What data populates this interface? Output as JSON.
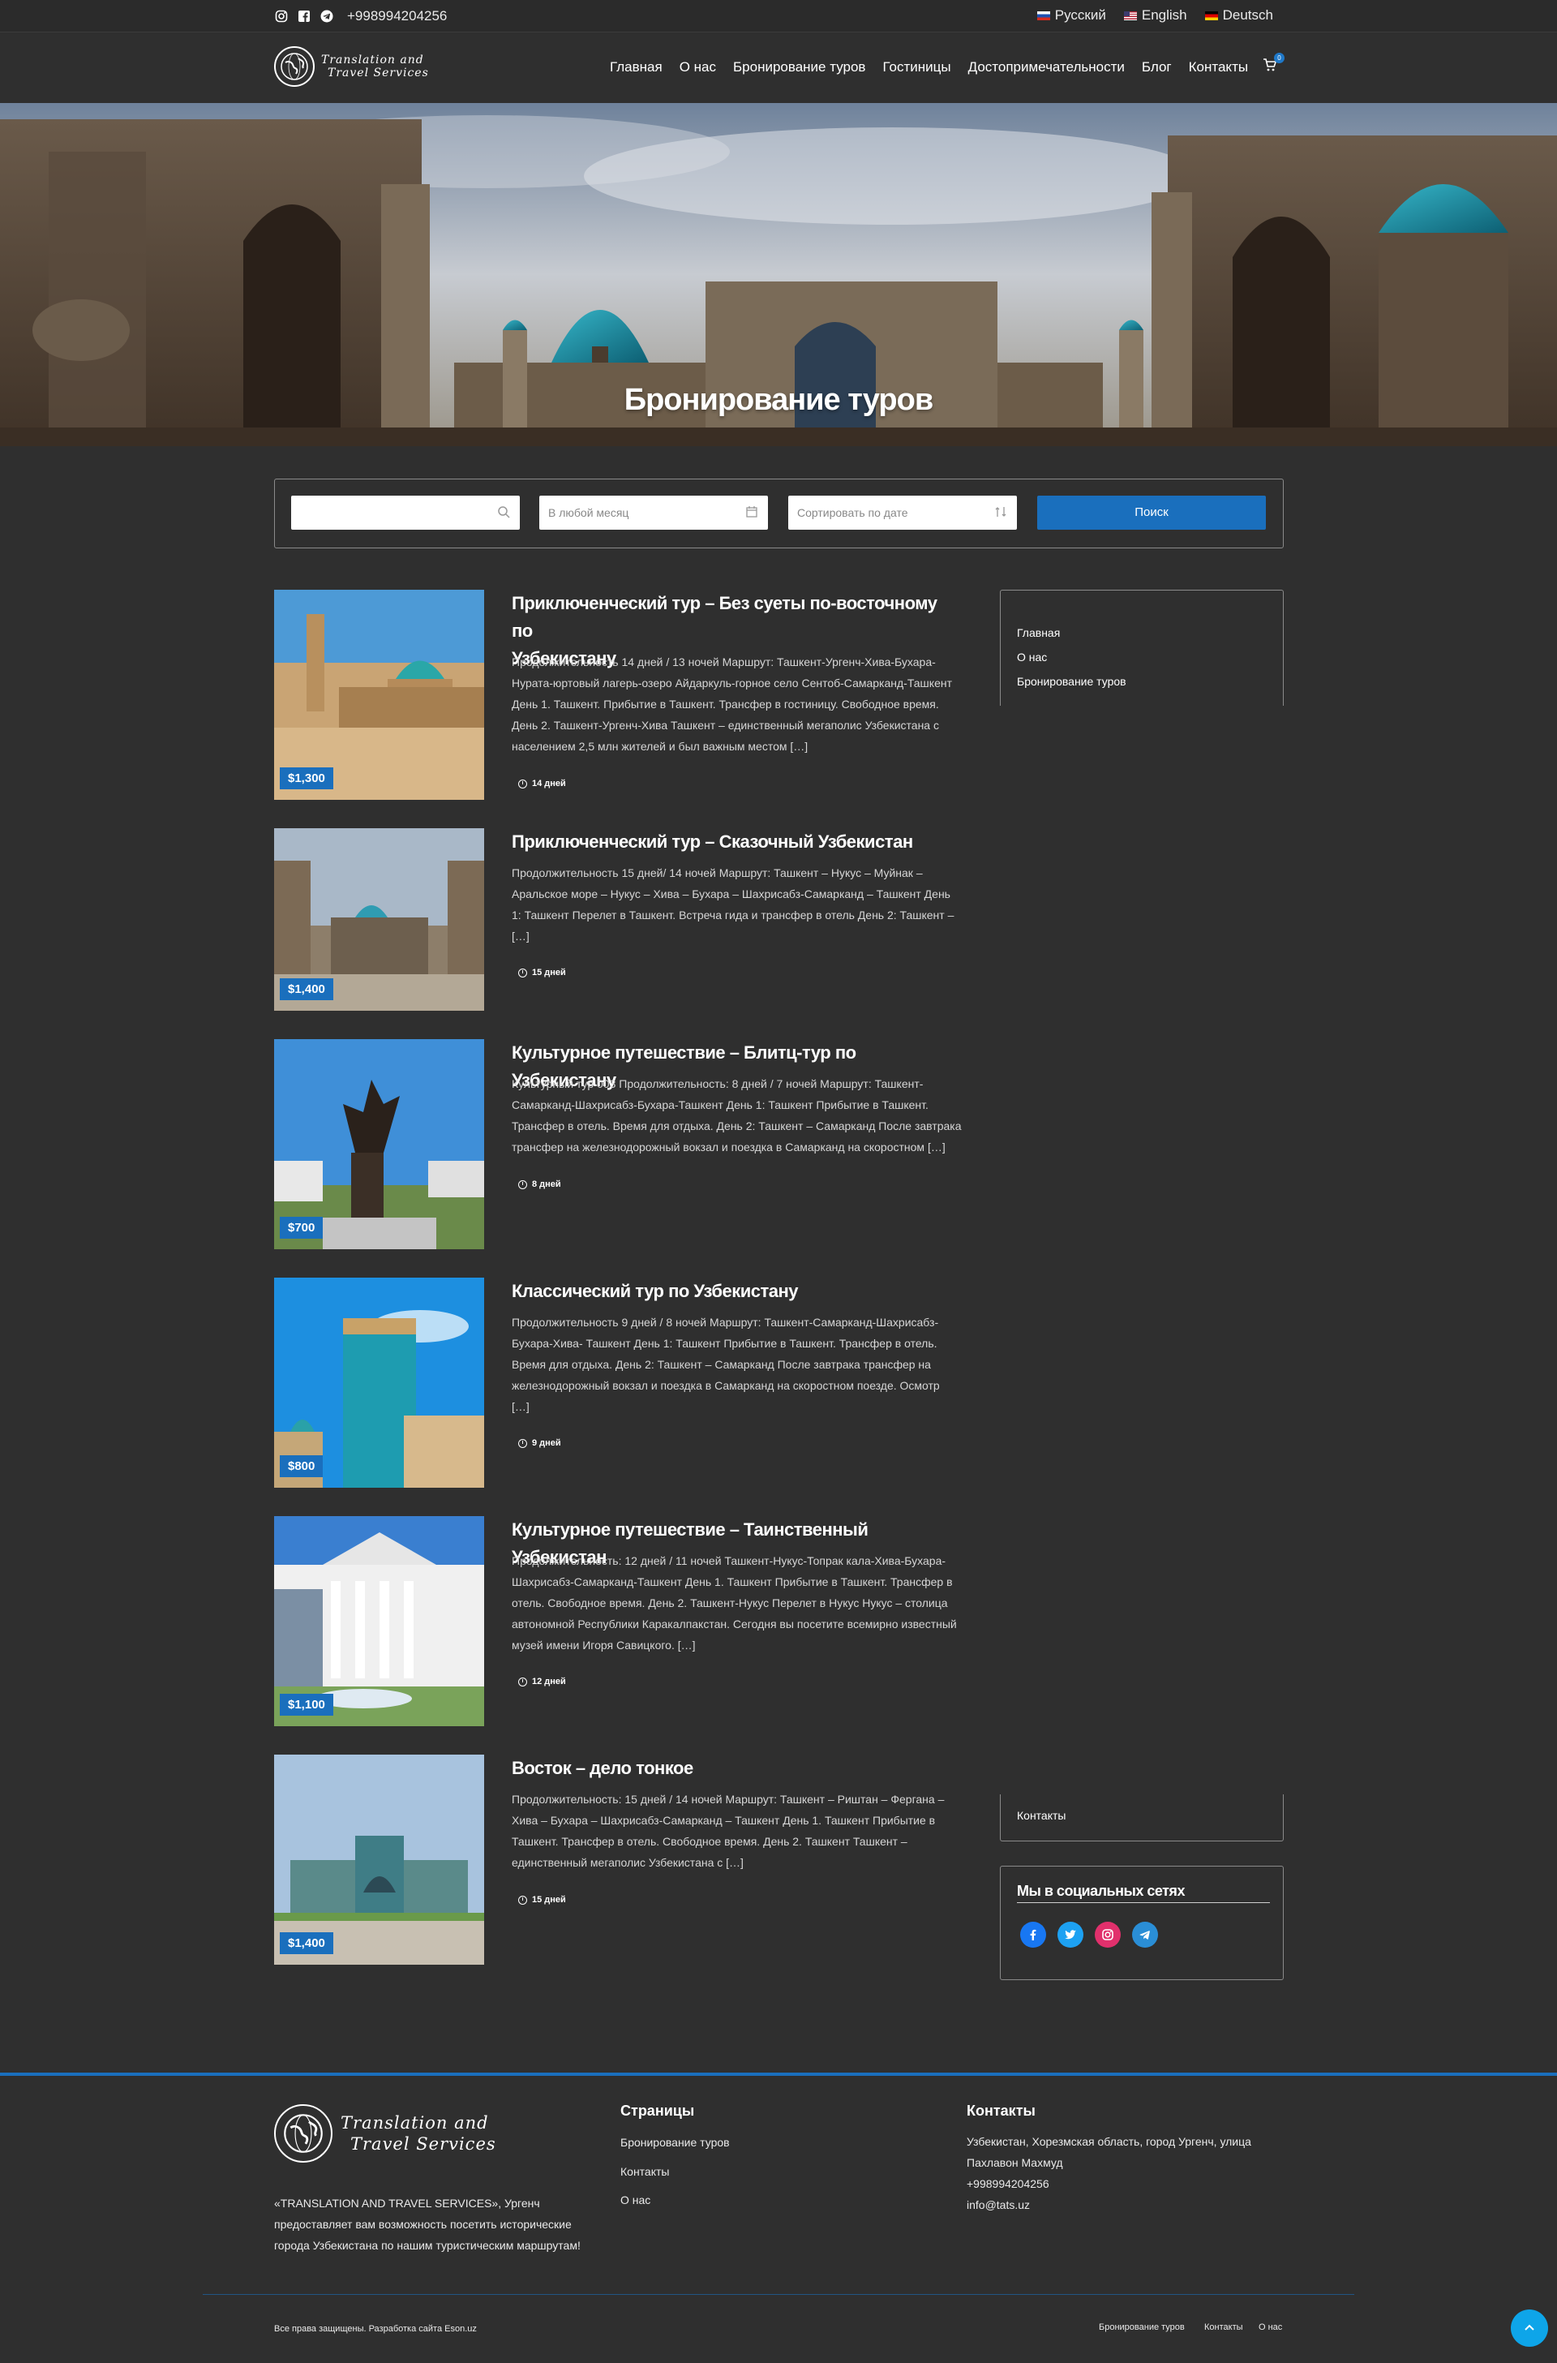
{
  "topbar": {
    "phone": "+998994204256",
    "languages": [
      {
        "label": "Русский",
        "flag": "ru"
      },
      {
        "label": "English",
        "flag": "en"
      },
      {
        "label": "Deutsch",
        "flag": "de"
      }
    ]
  },
  "header": {
    "logo_line1": "Translation and",
    "logo_line2": "Travel Services",
    "nav": [
      "Главная",
      "О нас",
      "Бронирование туров",
      "Гостиницы",
      "Достопримечательности",
      "Блог",
      "Контакты"
    ],
    "cart_count": "0"
  },
  "hero": {
    "title": "Бронирование туров"
  },
  "search": {
    "keyword_placeholder": "",
    "month_placeholder": "В любой месяц",
    "sort_placeholder": "Сортировать по дате",
    "button": "Поиск"
  },
  "tours": [
    {
      "title_1": "Приключенческий тур – Без суеты по-восточному по",
      "title_2": "Узбекистану",
      "desc": [
        "Продолжительность 14 дней / 13 ночей Маршрут: Ташкент-Ургенч-Хива-Бухара-",
        "Нурата-юртовый лагерь-озеро Айдаркуль-горное село Сентоб-Самарканд-Ташкент",
        "День 1. Ташкент. Прибытие в Ташкент. Трансфер в гостиницу. Свободное время.",
        "День 2. Ташкент-Ургенч-Хива Ташкент – единственный мегаполис Узбекистана с",
        "населением 2,5 млн жителей и был важным местом […]"
      ],
      "duration": "14 дней",
      "price": "$1,300"
    },
    {
      "title_1": "Приключенческий тур – Сказочный Узбекистан",
      "desc": [
        "Продолжительность 15 дней/ 14 ночей Маршрут: Ташкент – Нукус – Муйнак –",
        "Аральское море – Нукус – Хива – Бухара – Шахрисабз-Самарканд – Ташкент День",
        "1: Ташкент Перелет в Ташкент. Встреча гида и трансфер в отель День 2: Ташкент –",
        "[…]"
      ],
      "duration": "15 дней",
      "price": "$1,400"
    },
    {
      "title_1": "Культурное путешествие – Блитц-тур по Узбекистану",
      "desc": [
        "Культурный тур 003 Продолжительность: 8 дней / 7 ночей Маршрут: Ташкент-",
        "Самарканд-Шахрисабз-Бухара-Ташкент День 1: Ташкент Прибытие в Ташкент.",
        "Трансфер в отель. Время для отдыха. День 2: Ташкент – Самарканд После завтрака",
        "трансфер на железнодорожный вокзал и поездка в Самарканд на скоростном […]"
      ],
      "duration": "8 дней",
      "price": "$700"
    },
    {
      "title_1": "Классический тур по Узбекистану",
      "desc": [
        "Продолжительность 9 дней / 8 ночей Маршрут: Ташкент-Самарканд-Шахрисабз-",
        "Бухара-Хива- Ташкент День 1: Ташкент Прибытие в Ташкент. Трансфер в отель.",
        "Время для отдыха. День 2: Ташкент – Самарканд После завтрака трансфер на",
        "железнодорожный вокзал и поездка в Самарканд на скоростном поезде. Осмотр",
        "[…]"
      ],
      "duration": "9 дней",
      "price": "$800"
    },
    {
      "title_1": "Культурное путешествие – Таинственный Узбекистан",
      "desc": [
        "Продолжительность: 12 дней / 11 ночей Ташкент-Нукус-Топрак кала-Хива-Бухара-",
        "Шахрисабз-Самарканд-Ташкент День 1. Ташкент Прибытие в Ташкент. Трансфер в",
        "отель. Свободное время. День 2. Ташкент-Нукус Перелет в Нукус Нукус – столица",
        "автономной Республики Каракалпакстан. Сегодня вы посетите всемирно известный",
        "музей имени Игоря Савицкого. […]"
      ],
      "duration": "12 дней",
      "price": "$1,100"
    },
    {
      "title_1": "Восток – дело тонкое",
      "desc": [
        "Продолжительность: 15 дней / 14 ночей Маршрут: Ташкент – Риштан – Фергана –",
        "Хива – Бухара – Шахрисабз-Самарканд – Ташкент День 1. Ташкент Прибытие в",
        "Ташкент. Трансфер в отель. Свободное время. День 2. Ташкент Ташкент –",
        "единственный мегаполис Узбекистана с […]"
      ],
      "duration": "15 дней",
      "price": "$1,400"
    }
  ],
  "sidebar": {
    "menu_top": [
      "Главная",
      "О нас",
      "Бронирование туров"
    ],
    "menu_bottom": [
      "Контакты"
    ],
    "social_title": "Мы в социальных сетях"
  },
  "footer": {
    "logo_line1": "Translation and",
    "logo_line2": "Travel Services",
    "about": [
      "«TRANSLATION AND TRAVEL SERVICES», Ургенч",
      "предоставляет вам возможность посетить исторические",
      "города Узбекистана по нашим туристическим маршрутам!"
    ],
    "pages_title": "Страницы",
    "pages": [
      "Бронирование туров",
      "Контакты",
      "О нас"
    ],
    "contacts_title": "Контакты",
    "address_1": "Узбекистан, Хорезмская область, город Ургенч, улица",
    "address_2": "Пахлавон Махмуд",
    "phone": "+998994204256",
    "email": "info@tats.uz",
    "copyright": "Все права защищены. Разработка сайта Eson.uz",
    "bottom_links": [
      "Бронирование туров",
      "Контакты",
      "О нас"
    ]
  },
  "colors": {
    "accent": "#1a6fbd",
    "background": "#2f2f2f",
    "scroll_top": "#0ea5e9"
  }
}
